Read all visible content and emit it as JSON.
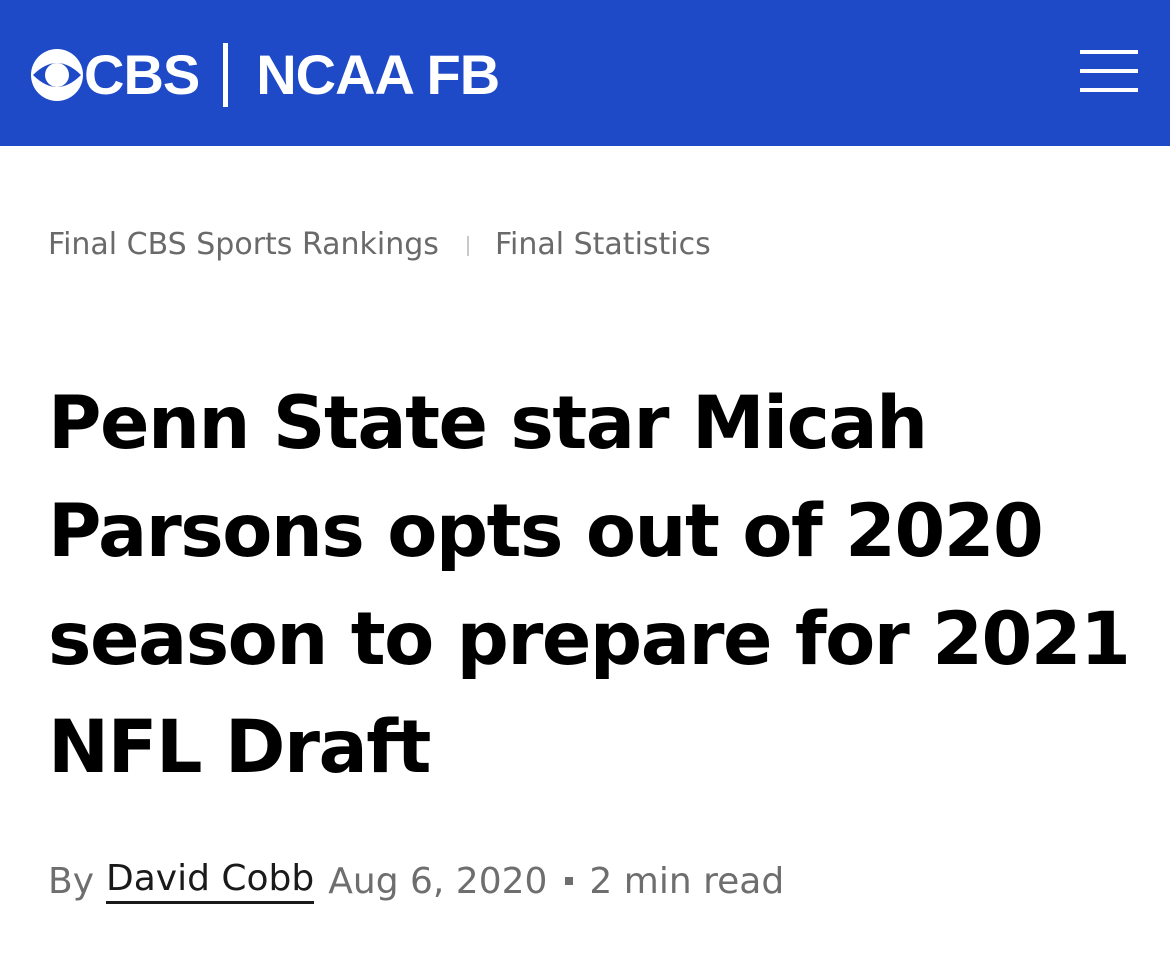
{
  "header": {
    "brand": "CBS",
    "section": "NCAA FB",
    "bg_color": "#1f4ac7",
    "menu_icon": "hamburger-menu-icon"
  },
  "subnav": {
    "items": [
      {
        "label": "Final CBS Sports Rankings"
      },
      {
        "label": "Final Statistics"
      }
    ]
  },
  "article": {
    "headline": "Penn State star Micah Parsons opts out of 2020 season to prepare for 2021 NFL Draft",
    "byline_prefix": "By",
    "author": "David Cobb",
    "date": "Aug 6, 2020",
    "read_time": "2 min read"
  }
}
